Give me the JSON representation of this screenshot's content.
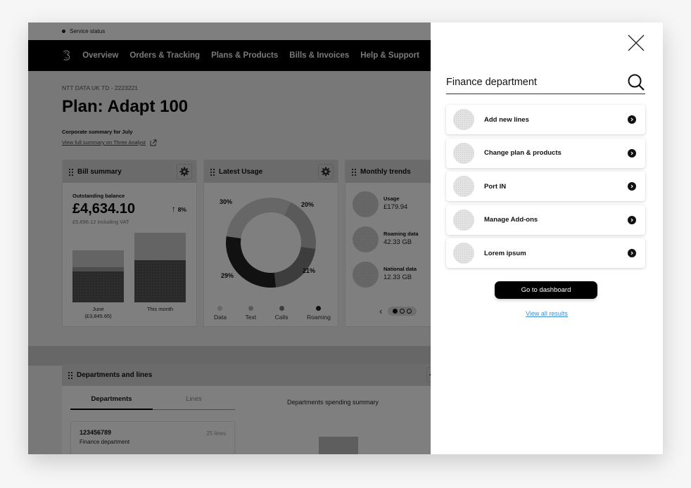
{
  "status_bar": {
    "label": "Service status"
  },
  "nav": {
    "items": [
      "Overview",
      "Orders & Tracking",
      "Plans & Products",
      "Bills & Invoices",
      "Help & Support"
    ]
  },
  "hero": {
    "account": "NTT DATA UK TD - 2223221",
    "title": "Plan: Adapt 100",
    "summary_title": "Corporate summary for July",
    "summary_link": "View full summary on Three Analyst"
  },
  "bill_summary": {
    "title": "Bill summary",
    "outstanding_label": "Outstanding balance",
    "outstanding_value": "£4,634.10",
    "trend": "8%",
    "vat_note": "£5,696.12 including VAT",
    "bars": [
      {
        "label": "June",
        "sublabel": "(£3,845.65)"
      },
      {
        "label": "This month",
        "sublabel": ""
      }
    ]
  },
  "latest_usage": {
    "title": "Latest Usage",
    "segments": [
      {
        "name": "Data",
        "percent": "30%",
        "color": "#cfcfcf"
      },
      {
        "name": "Text",
        "percent": "20%",
        "color": "#b5b5b5"
      },
      {
        "name": "Calls",
        "percent": "21%",
        "color": "#7a7a7a"
      },
      {
        "name": "Roaming",
        "percent": "29%",
        "color": "#222222"
      }
    ]
  },
  "monthly_trends": {
    "title": "Monthly trends",
    "items": [
      {
        "label": "Usage",
        "value": "£179.94"
      },
      {
        "label": "Roaming data",
        "value": "42.33 GB"
      },
      {
        "label": "National data",
        "value": "12.33 GB"
      }
    ]
  },
  "departments": {
    "title": "Departments and lines",
    "tabs": [
      "Departments",
      "Lines"
    ],
    "spending_title": "Departments spending summary",
    "card": {
      "id": "123456789",
      "lines": "25 lines",
      "name": "Finance department"
    }
  },
  "search_panel": {
    "query": "Finance department",
    "results": [
      "Add new lines",
      "Change plan & products",
      "Port IN",
      "Manage Add-ons",
      "Lorem ipsum"
    ],
    "dashboard_button": "Go to dashboard",
    "view_all": "View all results"
  }
}
